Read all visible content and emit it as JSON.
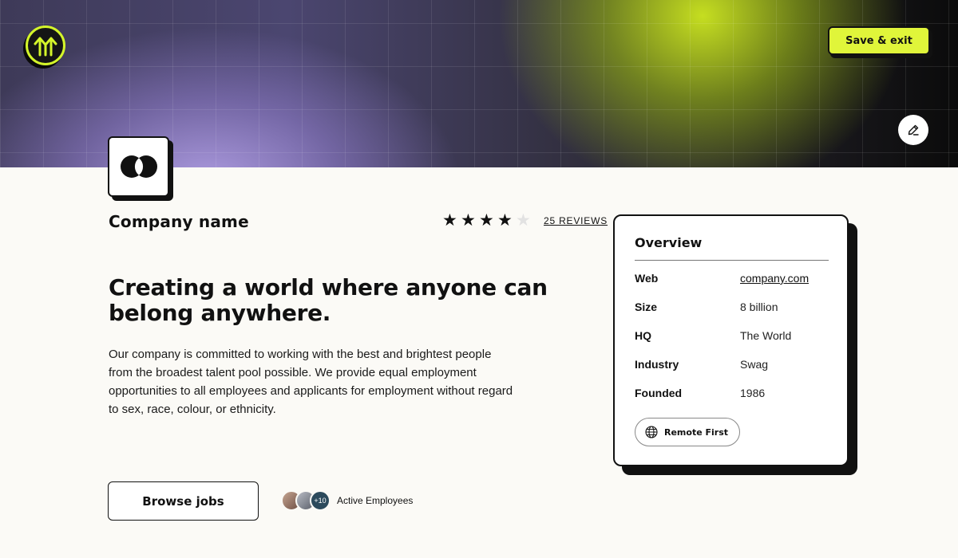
{
  "header": {
    "save_label": "Save & exit",
    "brand_icon": "arrows-up-circle-logo",
    "edit_icon": "pencil-icon",
    "accent_color": "#e0f53a"
  },
  "company": {
    "name": "Company name",
    "logo_icon": "overlapping-circles-logo",
    "rating": {
      "stars": 4,
      "max": 5
    },
    "reviews_label": "25 REVIEWS",
    "headline": "Creating a world where anyone can belong anywhere.",
    "description": "Our company is committed to working with the best and brightest people from the broadest talent pool possible. We provide equal employment opportunities to all employees and applicants for employment without regard to sex, race, colour, or ethnicity.",
    "browse_label": "Browse jobs",
    "employees": {
      "more_count": "+10",
      "label": "Active Employees"
    }
  },
  "overview": {
    "title": "Overview",
    "rows": [
      {
        "key": "Web",
        "value": "company.com"
      },
      {
        "key": "Size",
        "value": "8 billion"
      },
      {
        "key": "HQ",
        "value": "The World"
      },
      {
        "key": "Industry",
        "value": "Swag"
      },
      {
        "key": "Founded",
        "value": "1986"
      }
    ],
    "chip_label": "Remote First",
    "chip_icon": "globe-icon"
  }
}
